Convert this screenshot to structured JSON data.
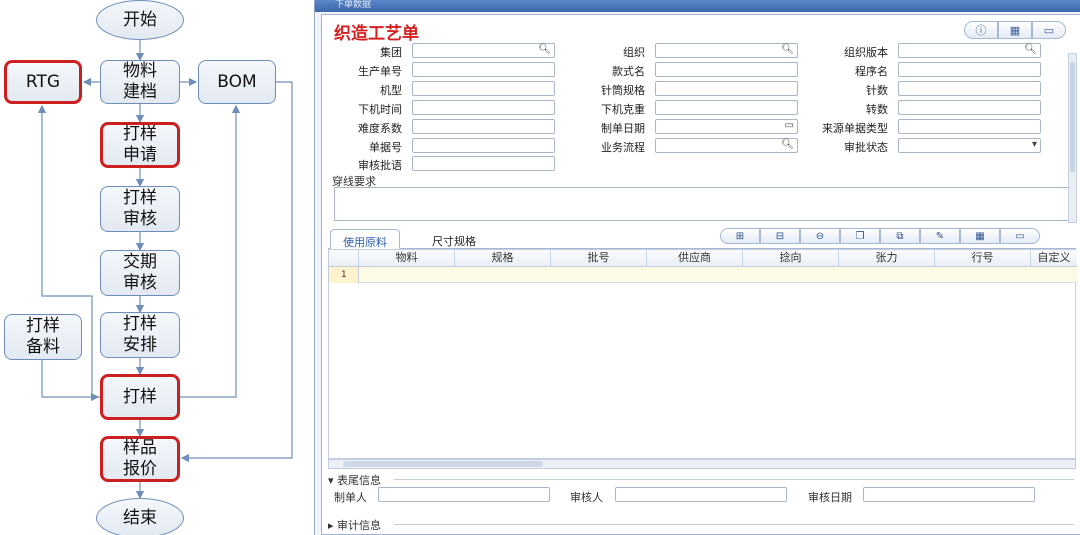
{
  "flowchart": {
    "start": "开始",
    "material_filing": "物料\n建档",
    "rtg": "RTG",
    "bom": "BOM",
    "sample_request": "打样\n申请",
    "sample_review": "打样\n审核",
    "delivery_review": "交期\n审核",
    "sample_arrange": "打样\n安排",
    "sample_prep": "打样\n备料",
    "sampling": "打样",
    "sample_quote": "样品\n报价",
    "end": "结束"
  },
  "window": {
    "title_text": "下单数据"
  },
  "form": {
    "title": "织造工艺单",
    "fields": {
      "group": "集团",
      "organization": "组织",
      "org_version": "组织版本",
      "production_no": "生产单号",
      "style_name": "款式名",
      "program_name": "程序名",
      "machine_type": "机型",
      "needle_spec": "针筒规格",
      "needle_count": "针数",
      "machine_time": "下机时间",
      "machine_weight": "下机克重",
      "rotation": "转数",
      "difficulty": "难度系数",
      "order_date": "制单日期",
      "source_type": "来源单据类型",
      "doc_no": "单据号",
      "business_flow": "业务流程",
      "approval_status": "审批状态",
      "review_note": "审核批语",
      "yarn_requirement": "穿线要求"
    }
  },
  "tabs": [
    {
      "label": "使用原料"
    },
    {
      "label": "尺寸规格"
    }
  ],
  "grid": {
    "columns": [
      "物料",
      "规格",
      "批号",
      "供应商",
      "捻向",
      "张力",
      "行号",
      "自定义"
    ],
    "rows": [
      {
        "no": "1"
      }
    ]
  },
  "footer": {
    "section_tail": "表尾信息",
    "creator": "制单人",
    "reviewer": "审核人",
    "review_date": "审核日期",
    "section_audit": "审计信息"
  },
  "colors": {
    "title_red": "#d42020",
    "highlight_border": "#cc2020",
    "node_border": "#6f8fb8"
  }
}
